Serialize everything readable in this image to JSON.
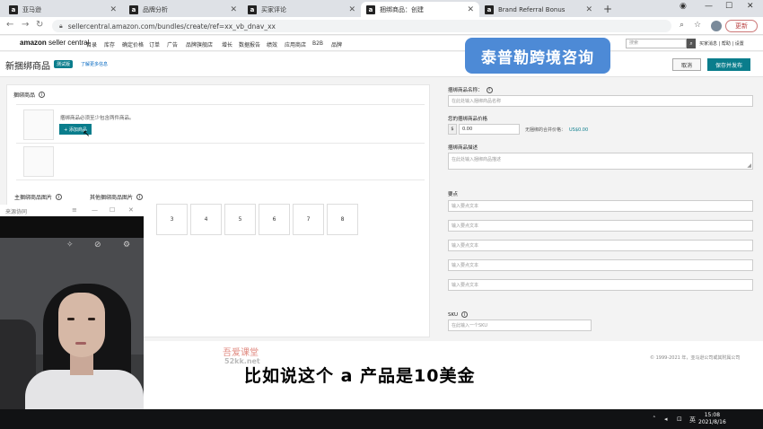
{
  "browser": {
    "tabs": [
      {
        "favicon": "a",
        "title": "亚马逊",
        "active": false
      },
      {
        "favicon": "a",
        "title": "品牌分析",
        "active": false
      },
      {
        "favicon": "a",
        "title": "买家评论",
        "active": false
      },
      {
        "favicon": "a",
        "title": "捆绑商品：创建",
        "active": true
      },
      {
        "favicon": "a",
        "title": "Brand Referral Bonus",
        "active": false
      }
    ],
    "url": "sellercentral.amazon.com/bundles/create/ref=xx_vb_dnav_xx",
    "update_label": "更新"
  },
  "seller_nav": {
    "logo_bold": "amazon",
    "logo_rest": " seller central",
    "items": [
      "目录",
      "库存",
      "确定价格",
      "订单",
      "广告",
      "品牌旗舰店",
      "增长",
      "数据报告",
      "绩效",
      "应用商店",
      "B2B",
      "品牌"
    ],
    "search_placeholder": "搜索",
    "links": "买家消息 | 帮助 | 设置"
  },
  "header": {
    "title": "新捆绑商品",
    "beta": "测试版",
    "learn_more": "了解更多信息",
    "cancel": "取消",
    "publish": "保存并发布"
  },
  "watermark": "泰普勒跨境咨询",
  "left": {
    "bundle_products_label": "捆绑商品",
    "hint": "捆绑商品必须至少包含两件商品。",
    "add_product": "+ 添加商品",
    "main_image_label": "主捆绑商品图片",
    "other_images_label": "其他捆绑商品图片",
    "image_slots": [
      "3",
      "4",
      "5",
      "6",
      "7",
      "8"
    ]
  },
  "right": {
    "name_label": "捆绑商品名称：",
    "name_placeholder": "在此处输入捆绑商品名称",
    "price_label": "您的捆绑商品价格",
    "currency": "$",
    "price_value": "0.00",
    "saving_label": "无捆绑的合并价格：",
    "saving_value": "US$0.00",
    "desc_label": "捆绑商品描述",
    "desc_placeholder": "在此处输入捆绑商品描述",
    "bullets_label": "要点",
    "bullets": [
      "输入要点文本",
      "输入要点文本",
      "输入要点文本",
      "输入要点文本",
      "输入要点文本"
    ],
    "sku_label": "SKU",
    "sku_placeholder": "在此输入一个SKU"
  },
  "footer": {
    "copyright": "© 1999-2021 年，亚马逊公司或其附属公司"
  },
  "overlay": {
    "watermark2": "吾爱课堂",
    "watermark3": "52kk.net",
    "subtitle": "比如说这个 a 产品是10美金"
  },
  "webcam": {
    "title": "来源协同"
  },
  "taskbar": {
    "ime": "英",
    "time": "15:08",
    "date": "2021/8/16"
  }
}
